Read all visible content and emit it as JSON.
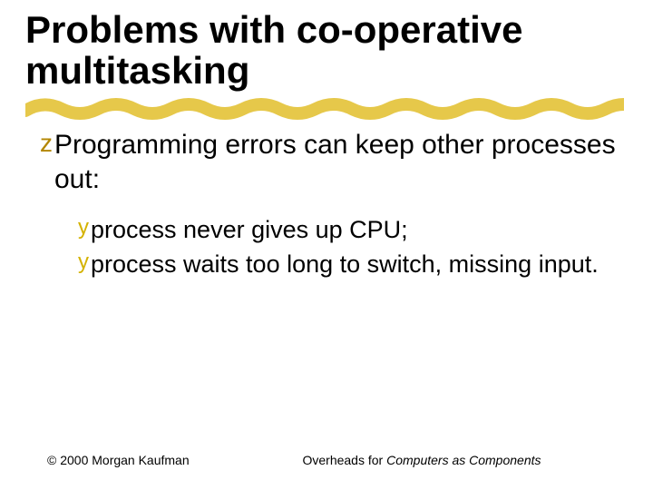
{
  "title": "Problems with co-operative multitasking",
  "bullets": {
    "main": {
      "symbol": "z",
      "text": "Programming errors can keep other processes out:"
    },
    "subs": [
      {
        "symbol": "y",
        "text": "process never gives up CPU;"
      },
      {
        "symbol": "y",
        "text": "process waits too long to switch, missing input."
      }
    ]
  },
  "footer": {
    "left": "© 2000 Morgan Kaufman",
    "center_prefix": "Overheads for ",
    "center_italic": "Computers as Components"
  }
}
